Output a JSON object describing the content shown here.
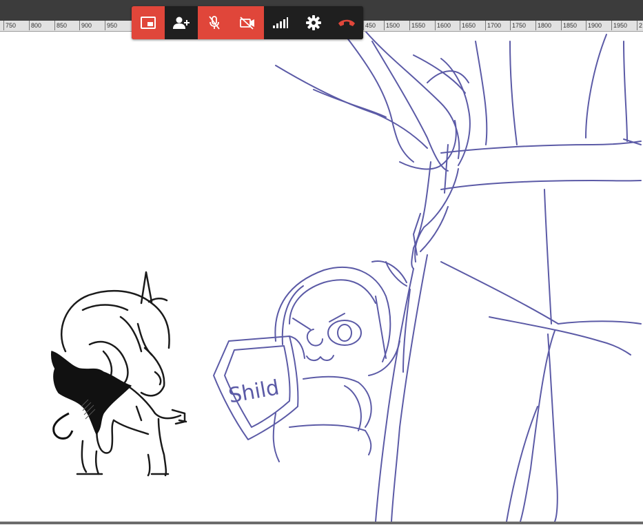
{
  "ruler": {
    "left_ticks": [
      "750",
      "800",
      "850",
      "900",
      "950"
    ],
    "right_ticks": [
      "450",
      "1500",
      "1550",
      "1600",
      "1650",
      "1700",
      "1750",
      "1800",
      "1850",
      "1900",
      "1950",
      "2"
    ]
  },
  "call_toolbar": {
    "buttons": [
      {
        "icon": "picture-in-picture-icon",
        "state": "active",
        "color": "#e0463a"
      },
      {
        "icon": "add-person-icon",
        "state": "normal",
        "color": "#1f1f1f"
      },
      {
        "icon": "microphone-off-icon",
        "state": "muted",
        "color": "#e0463a"
      },
      {
        "icon": "camera-off-icon",
        "state": "muted",
        "color": "#e0463a"
      },
      {
        "icon": "signal-strength-icon",
        "state": "normal",
        "color": "#1f1f1f"
      },
      {
        "icon": "settings-gear-icon",
        "state": "normal",
        "color": "#1f1f1f"
      },
      {
        "icon": "end-call-icon",
        "state": "normal",
        "color": "#1f1f1f",
        "glyph_color": "#e0463a"
      }
    ]
  },
  "canvas": {
    "shield_text": "Shild",
    "sketch_color": "#5b5aa6",
    "ink_color": "#1a1a1a"
  }
}
